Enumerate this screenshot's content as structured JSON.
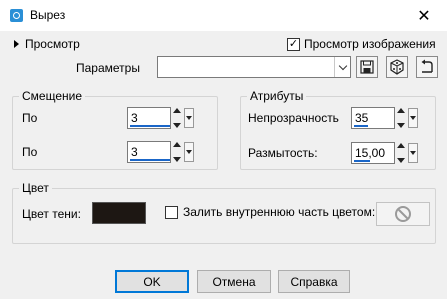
{
  "window": {
    "title": "Вырез",
    "close_glyph": "✕"
  },
  "preview": {
    "toggle_label": "Просмотр",
    "image_preview_label": "Просмотр изображения",
    "image_preview_checked": true,
    "check_glyph": "✓"
  },
  "params": {
    "label": "Параметры",
    "value": ""
  },
  "offset": {
    "title": "Смещение",
    "fields": [
      {
        "label": "По",
        "value": "3"
      },
      {
        "label": "По",
        "value": "3"
      }
    ]
  },
  "attributes": {
    "title": "Атрибуты",
    "opacity": {
      "label": "Непрозрачность",
      "value": "35"
    },
    "blur": {
      "label": "Размытость:",
      "value": "15,00"
    }
  },
  "color": {
    "title": "Цвет",
    "shadow_label": "Цвет тени:",
    "shadow_color": "#1d1713",
    "fill_inside_label": "Залить внутреннюю часть цветом:",
    "fill_inside_checked": false
  },
  "buttons": {
    "ok": "OK",
    "cancel": "Отмена",
    "help": "Справка"
  },
  "icons": {
    "app": "app-icon",
    "save": "save-icon",
    "settings": "cube-icon",
    "reset": "reset-arrow-icon",
    "none": "no-color-icon"
  }
}
